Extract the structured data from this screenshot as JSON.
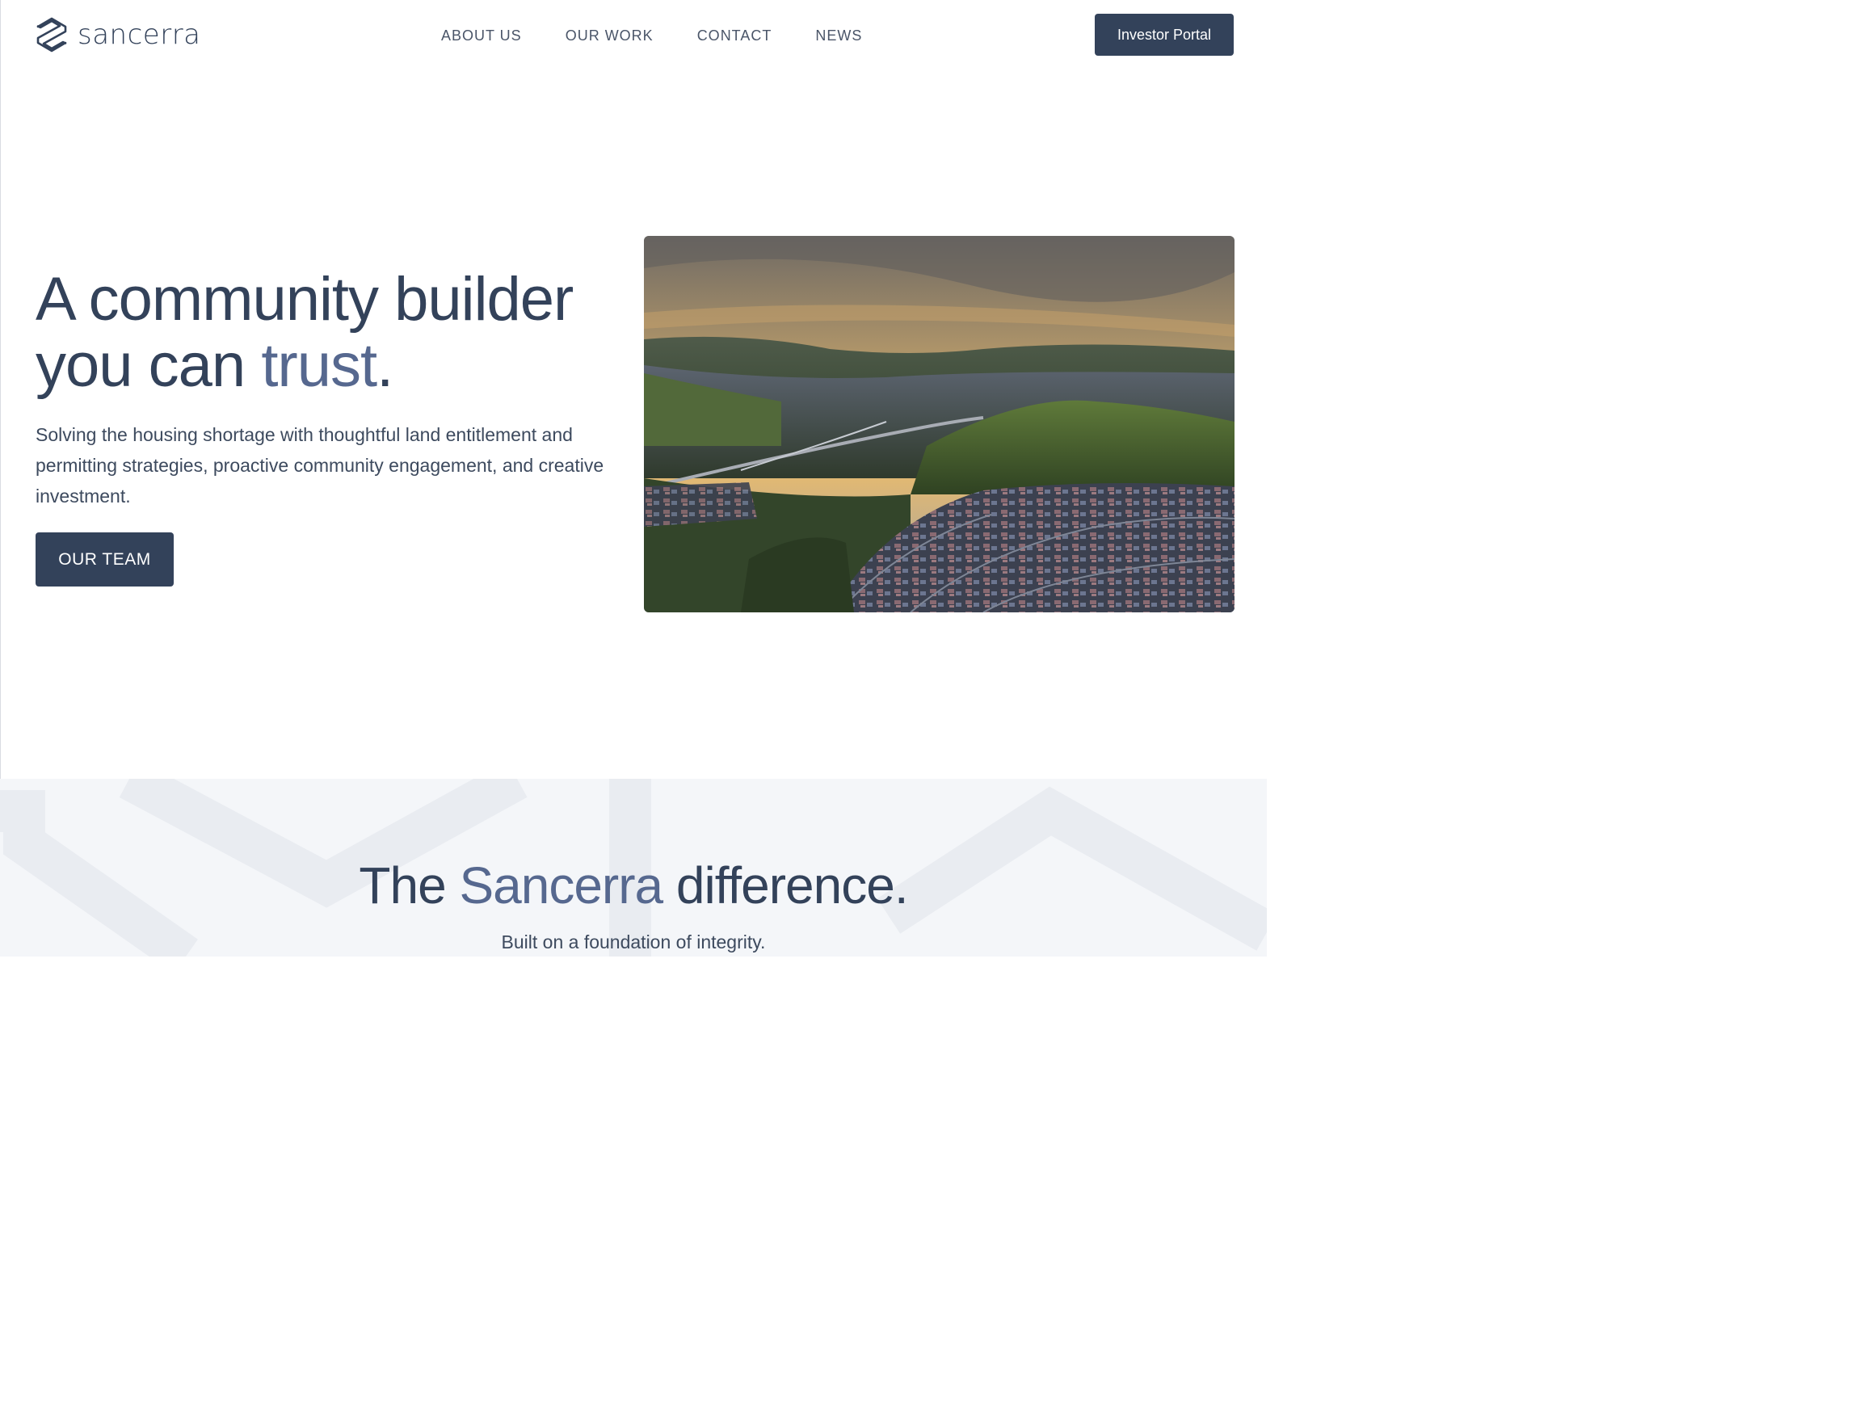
{
  "brand": {
    "name": "sancerra",
    "logo_icon": "hexagon-s-icon"
  },
  "nav": {
    "items": [
      {
        "label": "ABOUT US"
      },
      {
        "label": "OUR WORK"
      },
      {
        "label": "CONTACT"
      },
      {
        "label": "NEWS"
      }
    ],
    "cta_label": "Investor Portal"
  },
  "hero": {
    "title_line1": "A community builder",
    "title_line2_pre": "you can ",
    "title_line2_accent": "trust",
    "title_line2_post": ".",
    "subtitle": "Solving the housing shortage with thoughtful land entitlement and permitting strategies, proactive community engagement, and creative investment.",
    "button_label": "OUR TEAM",
    "image": "aerial-valley-neighborhood-photo"
  },
  "difference": {
    "title_pre": "The ",
    "title_accent": "Sancerra",
    "title_post": " difference.",
    "subtitle": "Built on a foundation of integrity."
  },
  "colors": {
    "primary": "#33425a",
    "accent": "#56688f",
    "section_bg": "#f4f6f9"
  }
}
